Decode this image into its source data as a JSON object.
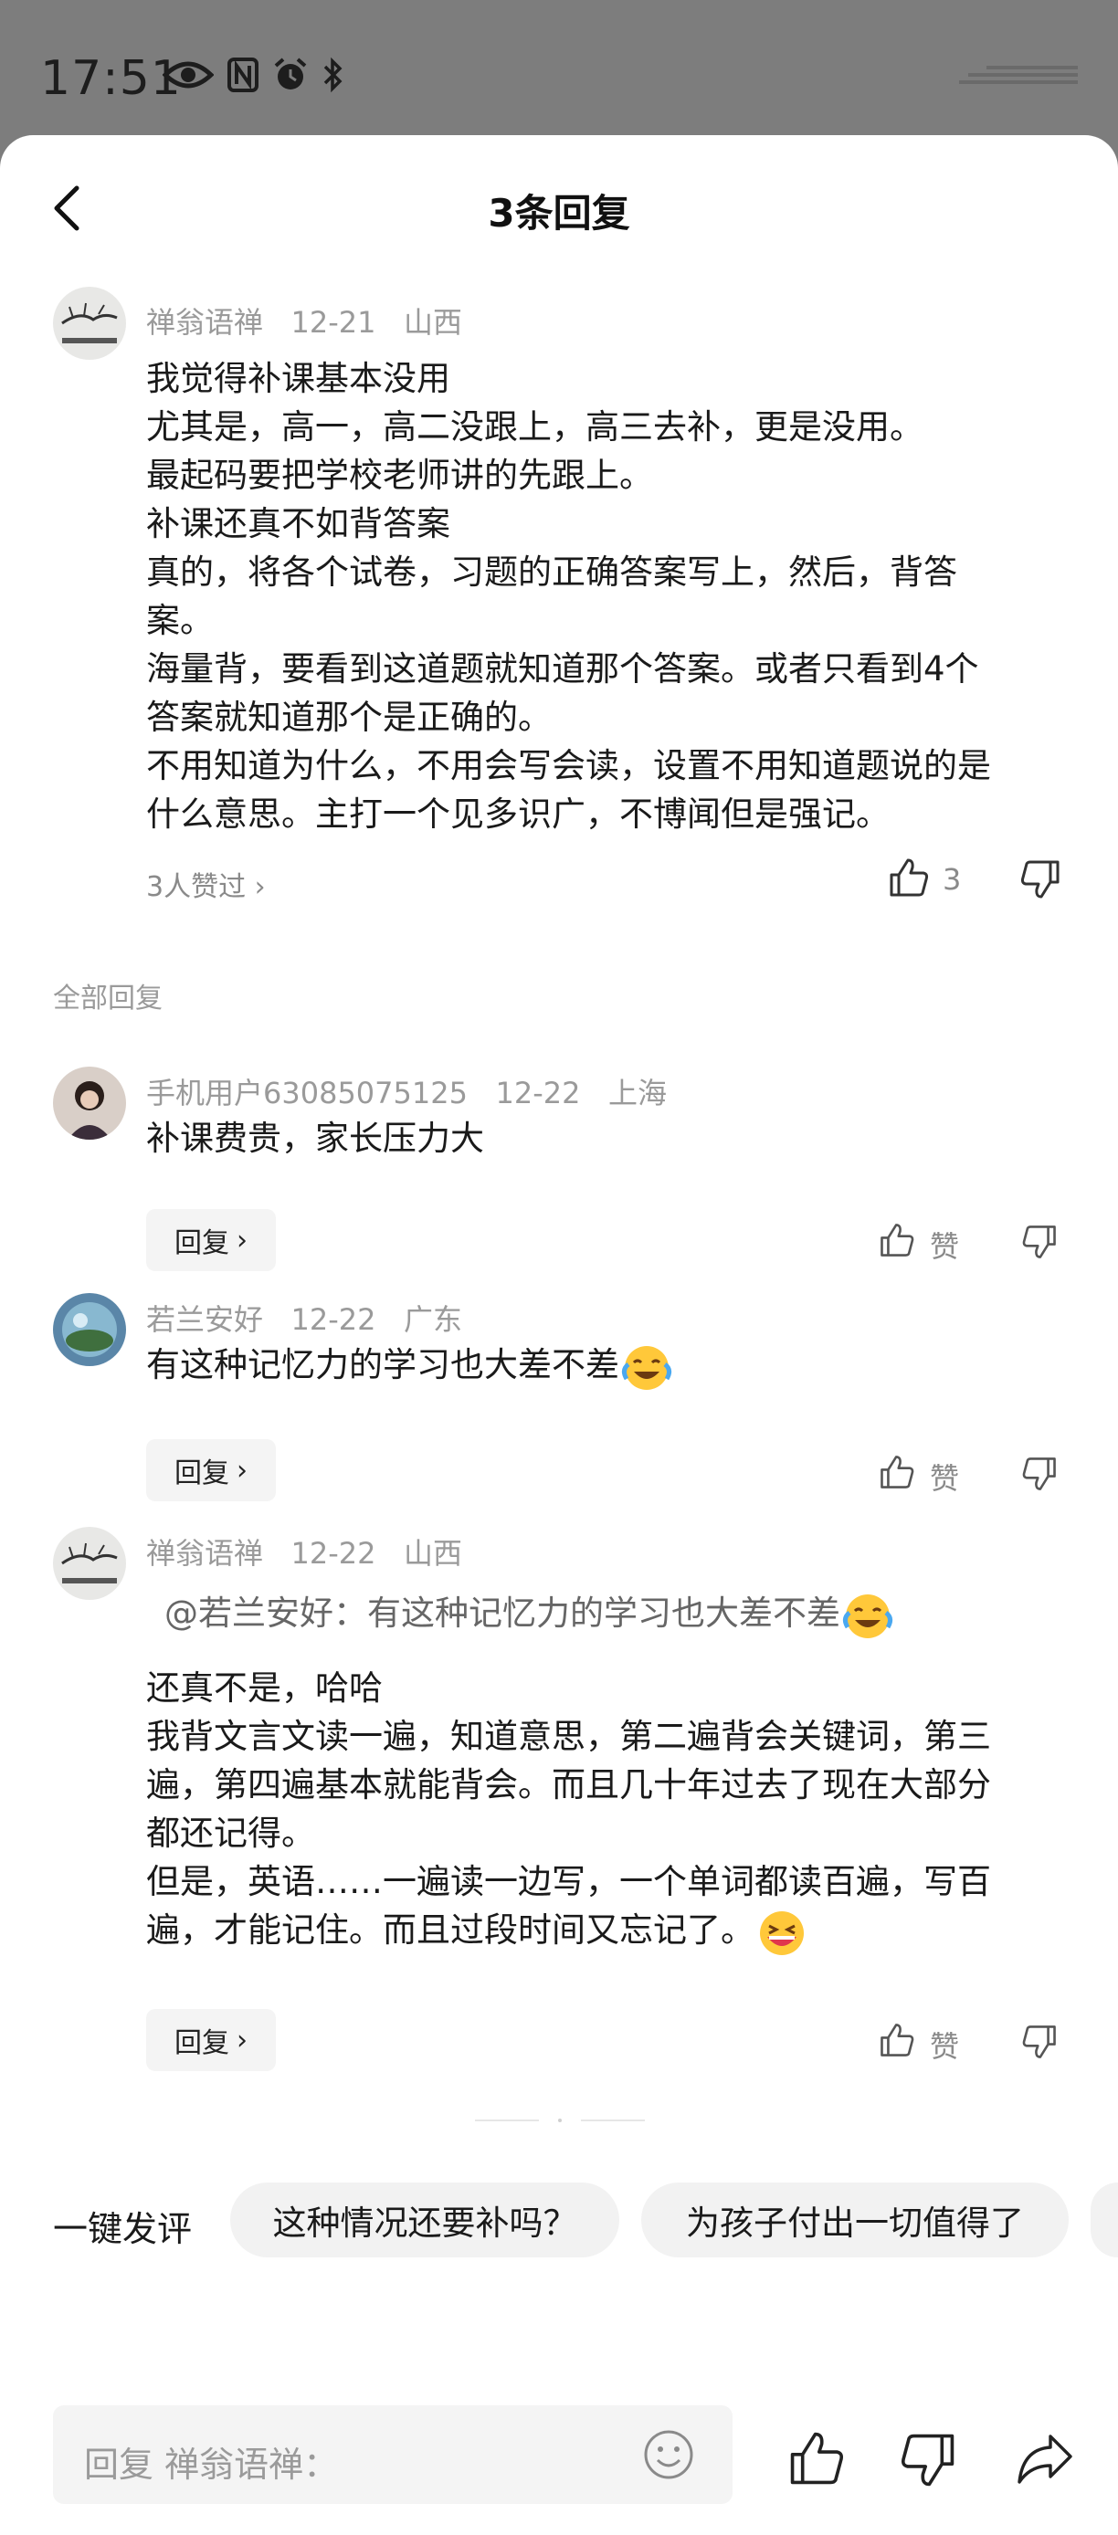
{
  "status_bar": {
    "time": "17:51"
  },
  "header": {
    "title": "3条回复"
  },
  "main_comment": {
    "author": "禅翁语禅",
    "date": "12-21",
    "location": "山西",
    "lines": [
      "我觉得补课基本没用",
      "尤其是，高一，高二没跟上，高三去补，更是没用。",
      "最起码要把学校老师讲的先跟上。",
      "补课还真不如背答案",
      "真的，将各个试卷，习题的正确答案写上，然后，背答",
      "案。",
      "海量背，要看到这道题就知道那个答案。或者只看到4个",
      "答案就知道那个是正确的。",
      "不用知道为什么，不用会写会读，设置不用知道题说的是",
      "什么意思。主打一个见多识广，不博闻但是强记。"
    ],
    "likers": "3人赞过",
    "like_count": "3"
  },
  "section_label": "全部回复",
  "replies": [
    {
      "author": "手机用户63085075125",
      "date": "12-22",
      "location": "上海",
      "text": "补课费贵，家长压力大",
      "reply_label": "回复",
      "like_label": "赞"
    },
    {
      "author": "若兰安好",
      "date": "12-22",
      "location": "广东",
      "text": "有这种记忆力的学习也大差不差",
      "emoji": "crying-laughing-emoji",
      "reply_label": "回复",
      "like_label": "赞"
    },
    {
      "author": "禅翁语禅",
      "date": "12-22",
      "location": "山西",
      "quote": "@若兰安好：有这种记忆力的学习也大差不差",
      "lines": [
        "还真不是，哈哈",
        "我背文言文读一遍，知道意思，第二遍背会关键词，第三",
        "遍，第四遍基本就能背会。而且几十年过去了现在大部分",
        "都还记得。",
        "但是，英语……一遍读一边写，一个单词都读百遍，写百",
        "遍，才能记住。而且过段时间又忘记了。"
      ],
      "emoji": "grinning-emoji",
      "reply_label": "回复",
      "like_label": "赞"
    }
  ],
  "quick_reply": {
    "label": "一键发评",
    "chips": [
      "这种情况还要补吗？",
      "为孩子付出一切值得了"
    ]
  },
  "input": {
    "placeholder": "回复 禅翁语禅："
  }
}
